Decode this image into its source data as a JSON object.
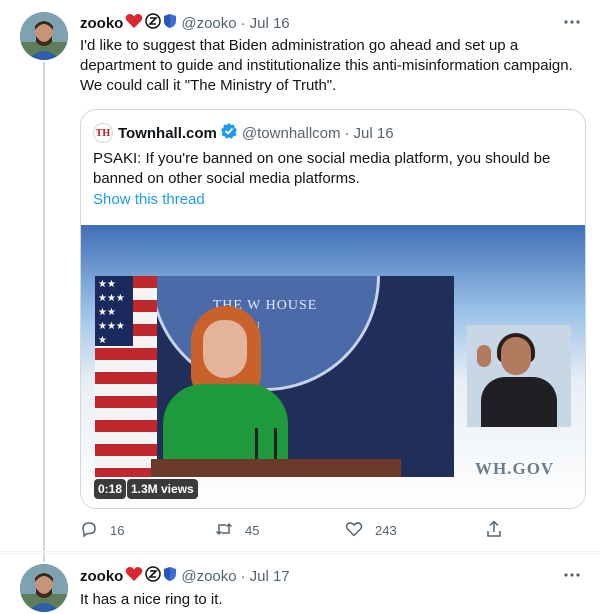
{
  "tweets": [
    {
      "author": {
        "name": "zooko",
        "badges": [
          "red-heart-icon",
          "zcash-icon",
          "shield-icon"
        ],
        "handle": "@zooko"
      },
      "separator": "·",
      "time": "Jul 16",
      "text": "I'd like to suggest that Biden administration go ahead and set up a department to guide and institutionalize this anti-misinformation campaign. We could call it \"The Ministry of Truth\".",
      "quote": {
        "author": {
          "name": "Townhall.com",
          "verified": true,
          "handle": "@townhallcom",
          "logo_text": "TH"
        },
        "time": "Jul 16",
        "text": "PSAKI: If you're banned on one social media platform, you should be banned on other social media platforms.",
        "link": "Show this thread",
        "video": {
          "duration": "0:18",
          "views": "1.3M views",
          "seal_text": "THE W   HOUSE",
          "seal_sub": "ON",
          "watermark": "WH.GOV"
        }
      },
      "actions": {
        "reply_count": "16",
        "retweet_count": "45",
        "like_count": "243"
      }
    },
    {
      "author": {
        "name": "zooko",
        "badges": [
          "red-heart-icon",
          "zcash-icon",
          "shield-icon"
        ],
        "handle": "@zooko"
      },
      "separator": "·",
      "time": "Jul 17",
      "text": "It has a nice ring to it."
    }
  ],
  "colors": {
    "link": "#1d9bf0",
    "secondary_text": "#536471",
    "border": "#cfd9de",
    "heart": "#d9262f"
  }
}
